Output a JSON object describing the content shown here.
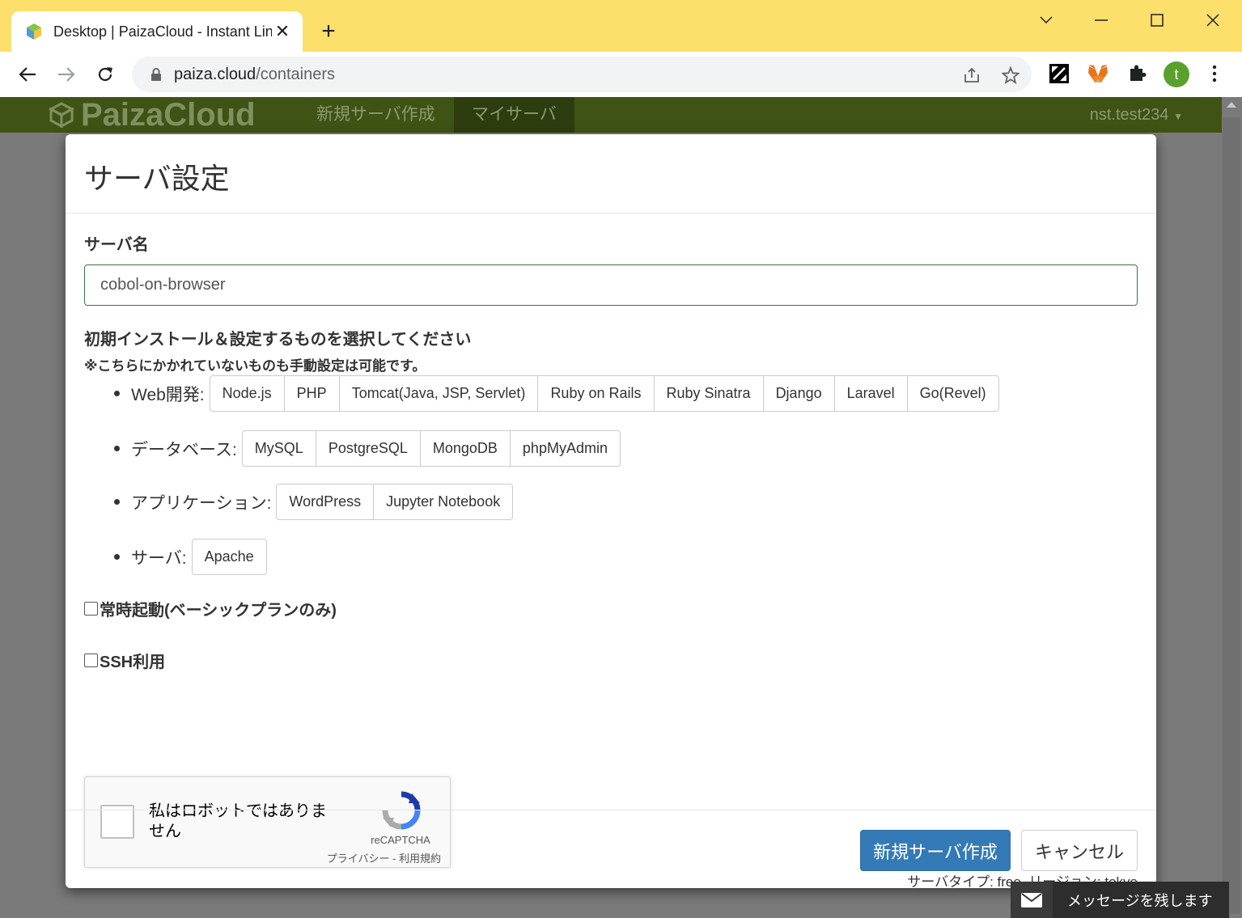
{
  "browser": {
    "tab_title": "Desktop | PaizaCloud - Instant Lin",
    "url_host": "paiza.cloud",
    "url_path": "/containers",
    "avatar_letter": "t",
    "accent_color": "#fce06b"
  },
  "site": {
    "logo_text": "PaizaCloud",
    "nav": [
      "新規サーバ作成",
      "マイサーバ"
    ],
    "user": "nst.test234"
  },
  "modal": {
    "title": "サーバ設定",
    "server_name_label": "サーバ名",
    "server_name_value": "cobol-on-browser",
    "install_title": "初期インストール＆設定するものを選択してください",
    "install_note": "※こちらにかかれていないものも手動設定は可能です。",
    "groups": [
      {
        "label": "Web開発:",
        "options": [
          "Node.js",
          "PHP",
          "Tomcat(Java, JSP, Servlet)",
          "Ruby on Rails",
          "Ruby Sinatra",
          "Django",
          "Laravel",
          "Go(Revel)"
        ]
      },
      {
        "label": "データベース:",
        "options": [
          "MySQL",
          "PostgreSQL",
          "MongoDB",
          "phpMyAdmin"
        ]
      },
      {
        "label": "アプリケーション:",
        "options": [
          "WordPress",
          "Jupyter Notebook"
        ]
      },
      {
        "label": "サーバ:",
        "options": [
          "Apache"
        ]
      }
    ],
    "always_on_label": "常時起動(ベーシックプランのみ)",
    "always_on_checked": false,
    "ssh_label": "SSH利用",
    "ssh_checked": false,
    "recaptcha": {
      "text": "私はロボットではありません",
      "brand": "reCAPTCHA",
      "links": "プライバシー - 利用規約"
    },
    "server_info": "サーバタイプ: free, リージョン: tokyo",
    "create_button": "新規サーバ作成",
    "cancel_button": "キャンセル",
    "primary_color": "#337ab7"
  },
  "message_widget": {
    "label": "メッセージを残します"
  }
}
